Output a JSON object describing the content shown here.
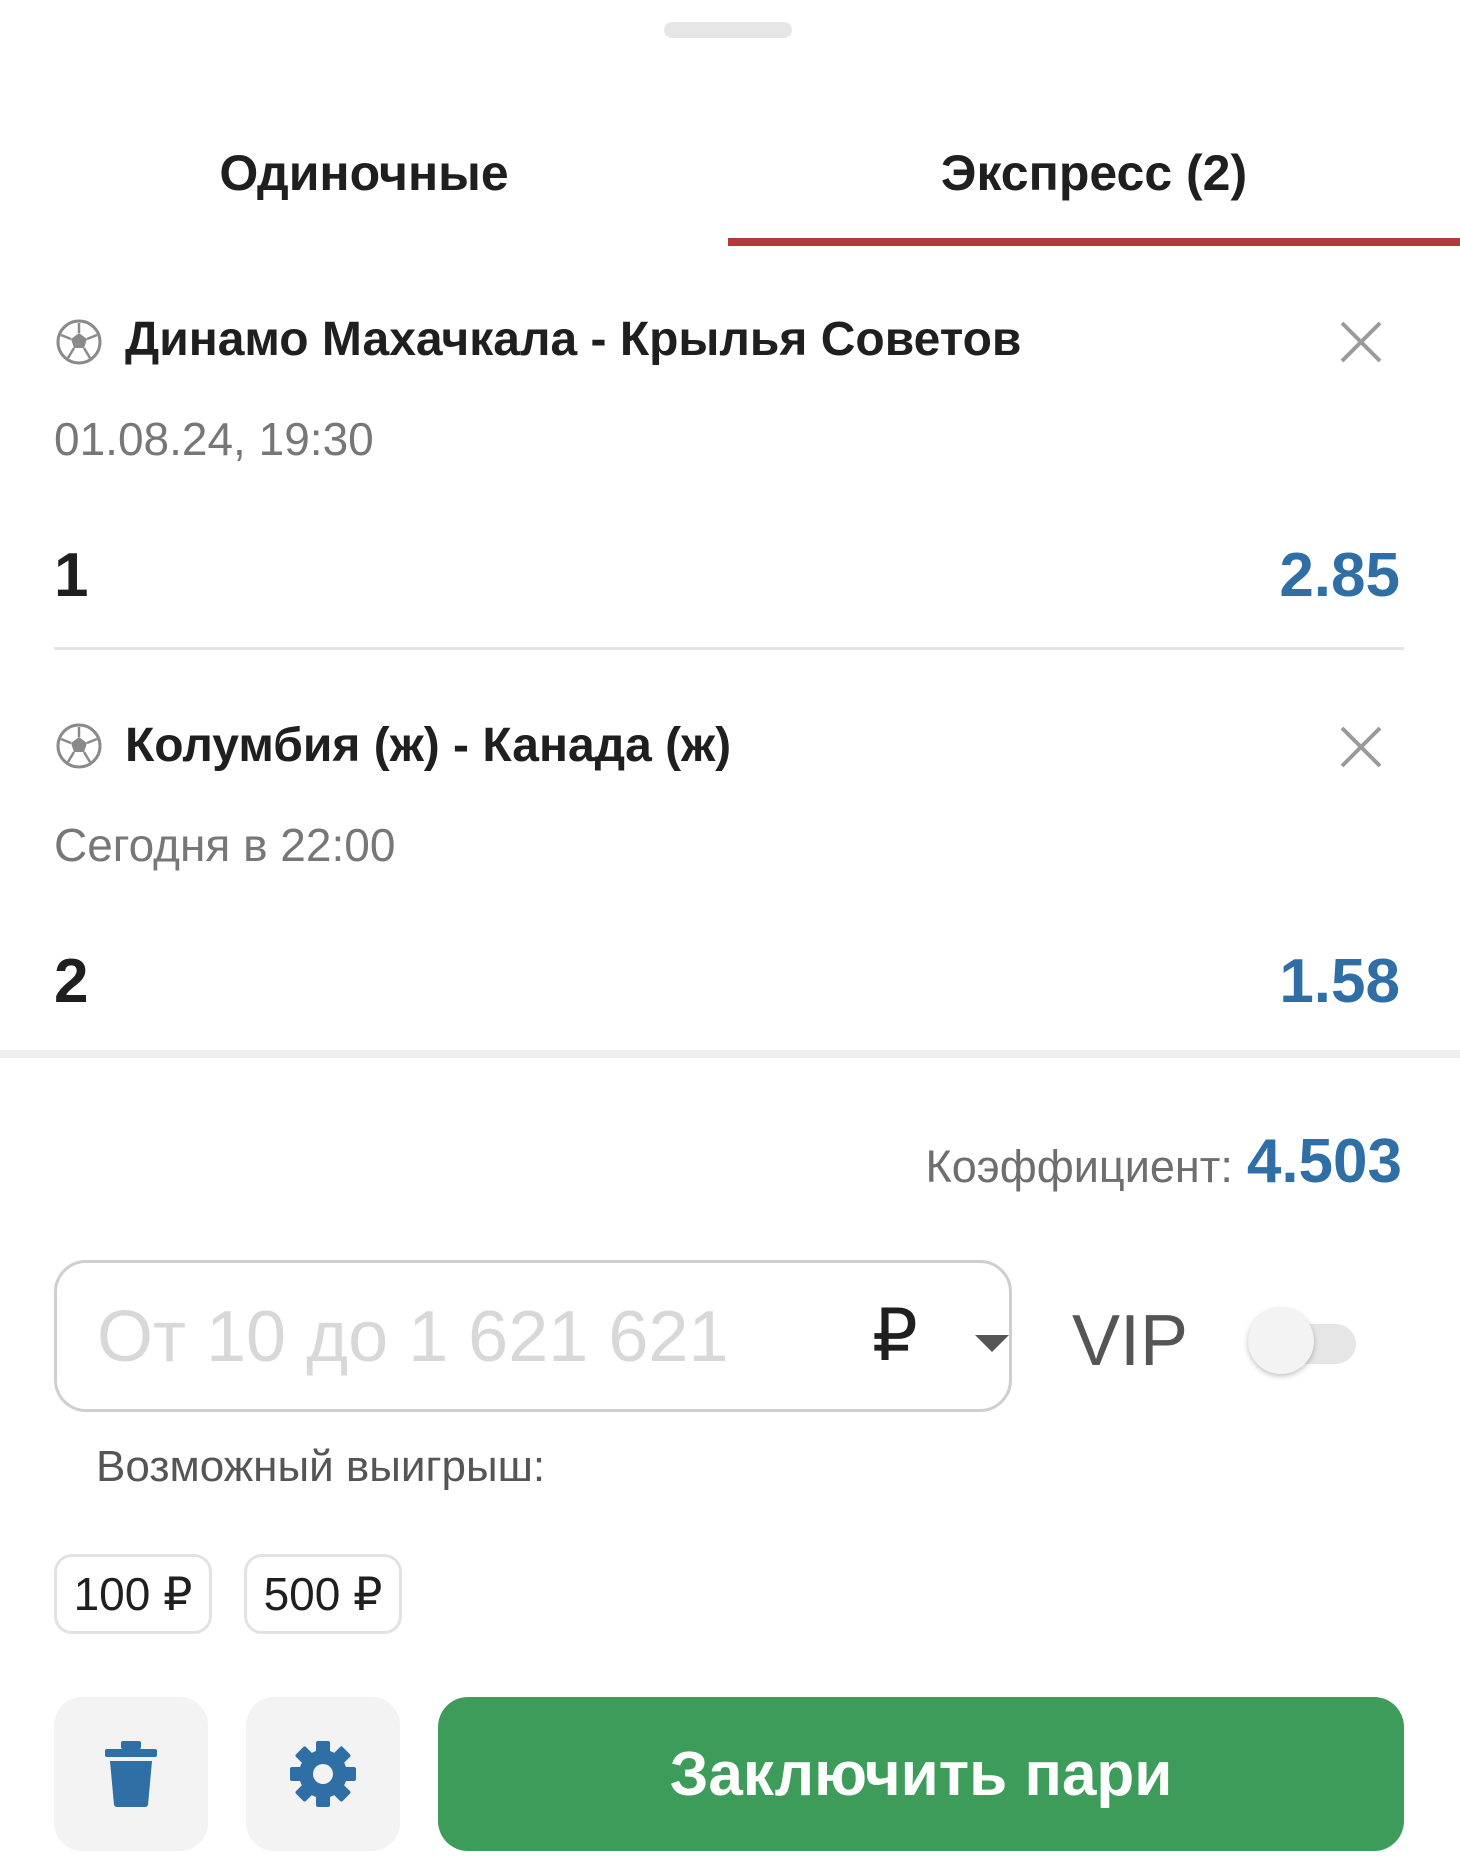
{
  "tabs": [
    {
      "label": "Одиночные",
      "active": false
    },
    {
      "label": "Экспресс (2)",
      "active": true
    }
  ],
  "bets": [
    {
      "match": "Динамо Махачкала - Крылья Советов",
      "time": "01.08.24, 19:30",
      "outcome": "1",
      "odd": "2.85",
      "sport_icon": "soccer-ball-icon"
    },
    {
      "match": "Колумбия (ж) - Канада (ж)",
      "time": "Сегодня в 22:00",
      "outcome": "2",
      "odd": "1.58",
      "sport_icon": "soccer-ball-icon"
    }
  ],
  "summary": {
    "coef_label": "Коэффициент:",
    "coef_value": "4.503"
  },
  "stake": {
    "placeholder": "От 10 до 1 621 621",
    "value": "",
    "currency": "₽"
  },
  "vip": {
    "label": "VIP",
    "enabled": false
  },
  "winnings_label": "Возможный выигрыш:",
  "quick_amounts": [
    "100 ₽",
    "500 ₽"
  ],
  "actions": {
    "delete_icon": "trash-icon",
    "settings_icon": "gear-icon",
    "submit_label": "Заключить пари"
  },
  "colors": {
    "accent_tab": "#b23a3a",
    "odd_blue": "#2f6fa6",
    "submit_green": "#3e9c5b"
  }
}
